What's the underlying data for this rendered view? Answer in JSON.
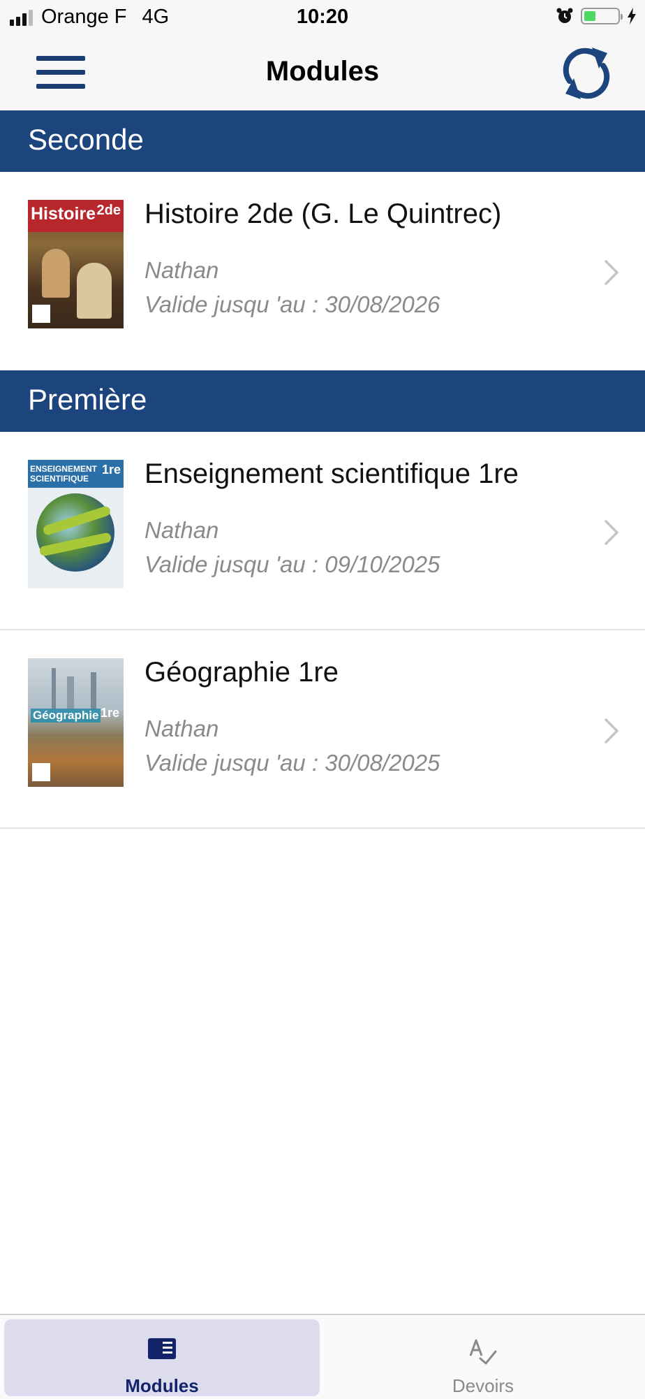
{
  "status_bar": {
    "carrier": "Orange F",
    "network": "4G",
    "time": "10:20",
    "battery_level": 0.35
  },
  "nav": {
    "title": "Modules",
    "menu_icon": "hamburger-menu-icon",
    "sync_icon": "sync-icon"
  },
  "sections": [
    {
      "title": "Seconde",
      "items": [
        {
          "title": "Histoire 2de (G. Le Quintrec)",
          "publisher": "Nathan",
          "validity": "Valide jusqu 'au : 30/08/2026",
          "cover_text": "Histoire",
          "cover_badge": "2de"
        }
      ]
    },
    {
      "title": "Première",
      "items": [
        {
          "title": "Enseignement scientifique 1re",
          "publisher": "Nathan",
          "validity": "Valide jusqu 'au : 09/10/2025",
          "cover_text": "ENSEIGNEMENT SCIENTIFIQUE",
          "cover_badge": "1re"
        },
        {
          "title": "Géographie 1re",
          "publisher": "Nathan",
          "validity": "Valide jusqu 'au : 30/08/2025",
          "cover_text": "Géographie",
          "cover_badge": "1re"
        }
      ]
    }
  ],
  "tabs": [
    {
      "label": "Modules",
      "icon": "book-icon",
      "active": true
    },
    {
      "label": "Devoirs",
      "icon": "spellcheck-icon",
      "active": false
    }
  ],
  "colors": {
    "primary": "#1c447d",
    "active_tab_bg": "#dcdcee",
    "active_tab_text": "#14246b",
    "inactive_tab_text": "#8a8a8a"
  }
}
